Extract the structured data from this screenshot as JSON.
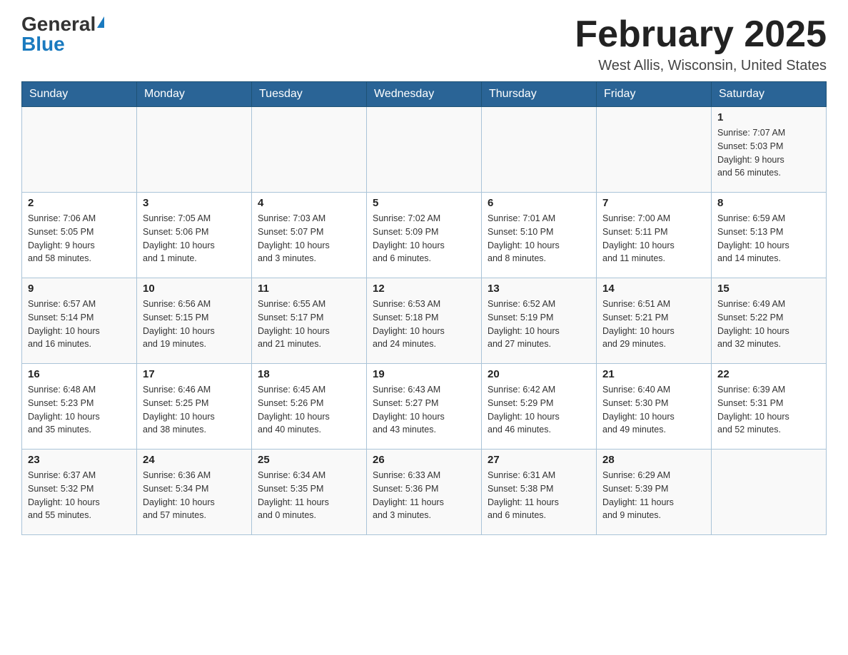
{
  "logo": {
    "general": "General",
    "blue": "Blue"
  },
  "header": {
    "title": "February 2025",
    "location": "West Allis, Wisconsin, United States"
  },
  "weekdays": [
    "Sunday",
    "Monday",
    "Tuesday",
    "Wednesday",
    "Thursday",
    "Friday",
    "Saturday"
  ],
  "weeks": [
    [
      {
        "day": "",
        "info": ""
      },
      {
        "day": "",
        "info": ""
      },
      {
        "day": "",
        "info": ""
      },
      {
        "day": "",
        "info": ""
      },
      {
        "day": "",
        "info": ""
      },
      {
        "day": "",
        "info": ""
      },
      {
        "day": "1",
        "info": "Sunrise: 7:07 AM\nSunset: 5:03 PM\nDaylight: 9 hours\nand 56 minutes."
      }
    ],
    [
      {
        "day": "2",
        "info": "Sunrise: 7:06 AM\nSunset: 5:05 PM\nDaylight: 9 hours\nand 58 minutes."
      },
      {
        "day": "3",
        "info": "Sunrise: 7:05 AM\nSunset: 5:06 PM\nDaylight: 10 hours\nand 1 minute."
      },
      {
        "day": "4",
        "info": "Sunrise: 7:03 AM\nSunset: 5:07 PM\nDaylight: 10 hours\nand 3 minutes."
      },
      {
        "day": "5",
        "info": "Sunrise: 7:02 AM\nSunset: 5:09 PM\nDaylight: 10 hours\nand 6 minutes."
      },
      {
        "day": "6",
        "info": "Sunrise: 7:01 AM\nSunset: 5:10 PM\nDaylight: 10 hours\nand 8 minutes."
      },
      {
        "day": "7",
        "info": "Sunrise: 7:00 AM\nSunset: 5:11 PM\nDaylight: 10 hours\nand 11 minutes."
      },
      {
        "day": "8",
        "info": "Sunrise: 6:59 AM\nSunset: 5:13 PM\nDaylight: 10 hours\nand 14 minutes."
      }
    ],
    [
      {
        "day": "9",
        "info": "Sunrise: 6:57 AM\nSunset: 5:14 PM\nDaylight: 10 hours\nand 16 minutes."
      },
      {
        "day": "10",
        "info": "Sunrise: 6:56 AM\nSunset: 5:15 PM\nDaylight: 10 hours\nand 19 minutes."
      },
      {
        "day": "11",
        "info": "Sunrise: 6:55 AM\nSunset: 5:17 PM\nDaylight: 10 hours\nand 21 minutes."
      },
      {
        "day": "12",
        "info": "Sunrise: 6:53 AM\nSunset: 5:18 PM\nDaylight: 10 hours\nand 24 minutes."
      },
      {
        "day": "13",
        "info": "Sunrise: 6:52 AM\nSunset: 5:19 PM\nDaylight: 10 hours\nand 27 minutes."
      },
      {
        "day": "14",
        "info": "Sunrise: 6:51 AM\nSunset: 5:21 PM\nDaylight: 10 hours\nand 29 minutes."
      },
      {
        "day": "15",
        "info": "Sunrise: 6:49 AM\nSunset: 5:22 PM\nDaylight: 10 hours\nand 32 minutes."
      }
    ],
    [
      {
        "day": "16",
        "info": "Sunrise: 6:48 AM\nSunset: 5:23 PM\nDaylight: 10 hours\nand 35 minutes."
      },
      {
        "day": "17",
        "info": "Sunrise: 6:46 AM\nSunset: 5:25 PM\nDaylight: 10 hours\nand 38 minutes."
      },
      {
        "day": "18",
        "info": "Sunrise: 6:45 AM\nSunset: 5:26 PM\nDaylight: 10 hours\nand 40 minutes."
      },
      {
        "day": "19",
        "info": "Sunrise: 6:43 AM\nSunset: 5:27 PM\nDaylight: 10 hours\nand 43 minutes."
      },
      {
        "day": "20",
        "info": "Sunrise: 6:42 AM\nSunset: 5:29 PM\nDaylight: 10 hours\nand 46 minutes."
      },
      {
        "day": "21",
        "info": "Sunrise: 6:40 AM\nSunset: 5:30 PM\nDaylight: 10 hours\nand 49 minutes."
      },
      {
        "day": "22",
        "info": "Sunrise: 6:39 AM\nSunset: 5:31 PM\nDaylight: 10 hours\nand 52 minutes."
      }
    ],
    [
      {
        "day": "23",
        "info": "Sunrise: 6:37 AM\nSunset: 5:32 PM\nDaylight: 10 hours\nand 55 minutes."
      },
      {
        "day": "24",
        "info": "Sunrise: 6:36 AM\nSunset: 5:34 PM\nDaylight: 10 hours\nand 57 minutes."
      },
      {
        "day": "25",
        "info": "Sunrise: 6:34 AM\nSunset: 5:35 PM\nDaylight: 11 hours\nand 0 minutes."
      },
      {
        "day": "26",
        "info": "Sunrise: 6:33 AM\nSunset: 5:36 PM\nDaylight: 11 hours\nand 3 minutes."
      },
      {
        "day": "27",
        "info": "Sunrise: 6:31 AM\nSunset: 5:38 PM\nDaylight: 11 hours\nand 6 minutes."
      },
      {
        "day": "28",
        "info": "Sunrise: 6:29 AM\nSunset: 5:39 PM\nDaylight: 11 hours\nand 9 minutes."
      },
      {
        "day": "",
        "info": ""
      }
    ]
  ]
}
